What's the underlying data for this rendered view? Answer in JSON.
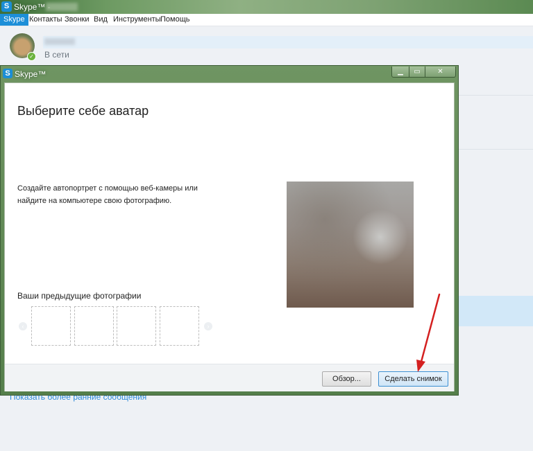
{
  "main_window": {
    "title": "Skype™ -"
  },
  "menu": {
    "items": [
      "Skype",
      "Контакты",
      "Звонки",
      "Вид",
      "Инструменты",
      "Помощь"
    ]
  },
  "profile": {
    "status": "В сети"
  },
  "older_messages_link": "Показать более ранние сообщения",
  "dialog": {
    "title": "Skype™",
    "heading": "Выберите себе аватар",
    "description": "Создайте автопортрет с помощью веб-камеры или найдите на компьютере свою фотографию.",
    "previous_photos_label": "Ваши предыдущие фотографии",
    "thumbnail_slots": 4,
    "buttons": {
      "browse": "Обзор...",
      "take_snapshot": "Сделать снимок"
    },
    "window_controls": [
      "minimize-icon",
      "maximize-icon",
      "close-icon"
    ]
  },
  "colors": {
    "accent": "#1d8fd8",
    "titlebar_green": "#6d9a62",
    "annotation_arrow": "#d42020",
    "status_online": "#6cb33e"
  }
}
